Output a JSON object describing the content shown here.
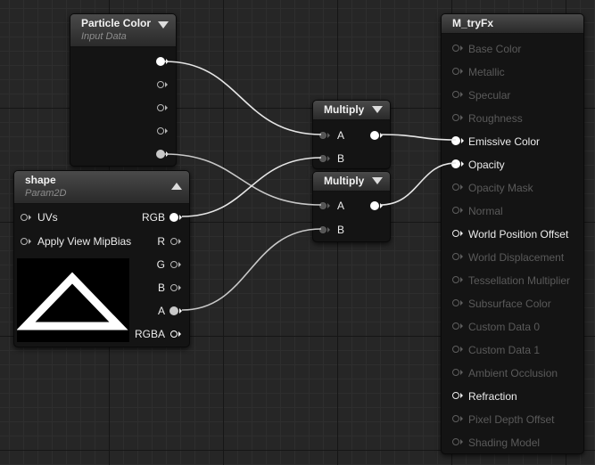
{
  "particle_color": {
    "title": "Particle Color",
    "subtitle": "Input Data"
  },
  "shape": {
    "title": "shape",
    "subtitle": "Param2D",
    "inputs": [
      "UVs",
      "Apply View MipBias"
    ],
    "outputs": [
      "RGB",
      "R",
      "G",
      "B",
      "A",
      "RGBA"
    ]
  },
  "multiply_1": {
    "title": "Multiply",
    "inputs": [
      "A",
      "B"
    ]
  },
  "multiply_2": {
    "title": "Multiply",
    "inputs": [
      "A",
      "B"
    ]
  },
  "material": {
    "title": "M_tryFx",
    "inputs": [
      {
        "label": "Base Color",
        "active": false
      },
      {
        "label": "Metallic",
        "active": false
      },
      {
        "label": "Specular",
        "active": false
      },
      {
        "label": "Roughness",
        "active": false
      },
      {
        "label": "Emissive Color",
        "active": true
      },
      {
        "label": "Opacity",
        "active": true
      },
      {
        "label": "Opacity Mask",
        "active": false
      },
      {
        "label": "Normal",
        "active": false
      },
      {
        "label": "World Position Offset",
        "active": true
      },
      {
        "label": "World Displacement",
        "active": false
      },
      {
        "label": "Tessellation Multiplier",
        "active": false
      },
      {
        "label": "Subsurface Color",
        "active": false
      },
      {
        "label": "Custom Data 0",
        "active": false
      },
      {
        "label": "Custom Data 1",
        "active": false
      },
      {
        "label": "Ambient Occlusion",
        "active": false
      },
      {
        "label": "Refraction",
        "active": true
      },
      {
        "label": "Pixel Depth Offset",
        "active": false
      },
      {
        "label": "Shading Model",
        "active": false
      }
    ]
  },
  "colors": {
    "background": "#262626",
    "node_body": "#141414",
    "wire": "#e6e6e6",
    "active_pin": "#ffffff",
    "inactive_text": "#5a5a5a"
  }
}
